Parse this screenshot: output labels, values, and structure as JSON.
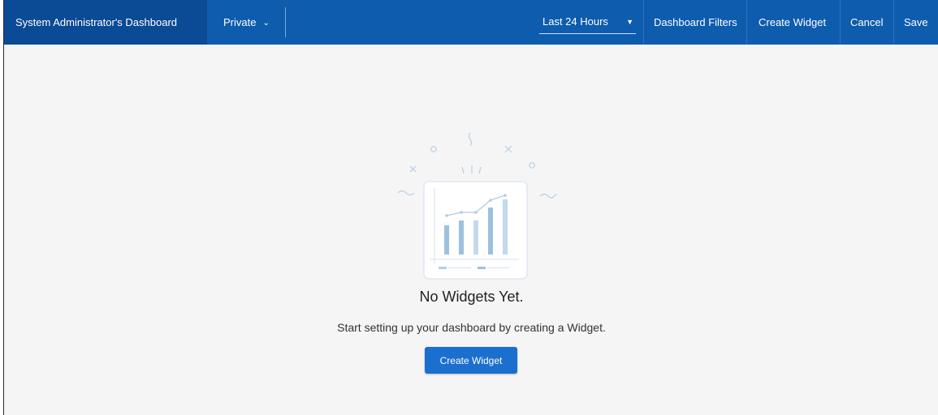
{
  "header": {
    "title": "System Administrator's Dashboard",
    "visibility": {
      "value": "Private"
    },
    "time_range": {
      "value": "Last 24 Hours"
    },
    "actions": {
      "filters": "Dashboard Filters",
      "create_widget": "Create Widget",
      "cancel": "Cancel",
      "save": "Save"
    }
  },
  "empty_state": {
    "title": "No Widgets Yet.",
    "subtitle": "Start setting up your dashboard by creating a Widget.",
    "button_label": "Create Widget"
  },
  "colors": {
    "header_bg": "#0e5cae",
    "title_block_bg": "#0b4a94",
    "page_bg": "#f5f5f5",
    "button_bg": "#1b6fcf"
  }
}
